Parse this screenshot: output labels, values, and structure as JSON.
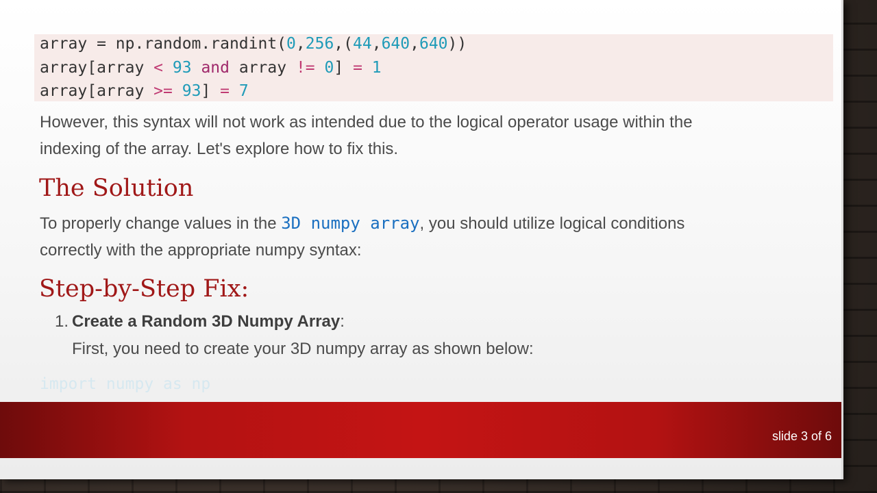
{
  "code_block": {
    "line1": {
      "a": "array = np.random.randint(",
      "n1": "0",
      "c1": ",",
      "n2": "256",
      "c2": ",(",
      "n3": "44",
      "c3": ",",
      "n4": "640",
      "c4": ",",
      "n5": "640",
      "end": "))"
    },
    "line2": {
      "a": "array[array ",
      "op1": "<",
      "sp1": " ",
      "n1": "93",
      "sp2": " ",
      "kw": "and",
      "b": " array ",
      "op2": "!=",
      "sp3": " ",
      "n2": "0",
      "c": "] ",
      "op3": "=",
      "sp4": " ",
      "n3": "1"
    },
    "line3": {
      "a": "array[array ",
      "op1": ">=",
      "sp1": " ",
      "n1": "93",
      "c": "] ",
      "op2": "=",
      "sp2": " ",
      "n2": "7"
    }
  },
  "paragraph1": {
    "line1": "However, this syntax will not work as intended due to the logical operator usage within the",
    "line2": "indexing of the array. Let's explore how to fix this."
  },
  "heading_solution": "The Solution",
  "paragraph2": {
    "pre": "To properly change values in the ",
    "code": "3D numpy array",
    "post": ", you should utilize logical conditions",
    "line2": "correctly with the appropriate numpy syntax:"
  },
  "heading_fix": "Step-by-Step Fix:",
  "list": {
    "number": "1.",
    "title": "Create a Random 3D Numpy Array",
    "colon": ":",
    "sub": "First, you need to create your 3D numpy array as shown below:"
  },
  "faded_code": "import numpy as np",
  "footer": {
    "slide_counter": "slide 3 of 6"
  }
}
